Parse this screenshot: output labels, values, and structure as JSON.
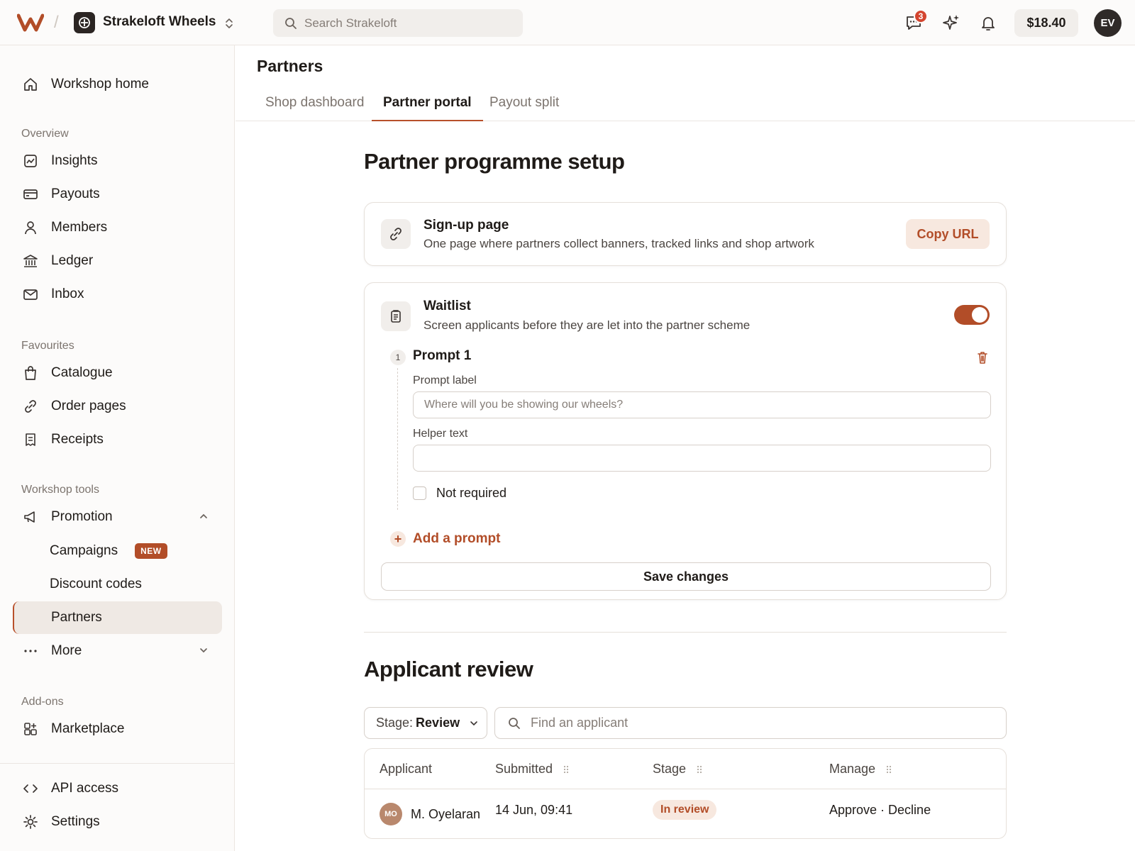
{
  "topbar": {
    "workspace_name": "Strakeloft Wheels",
    "search_placeholder": "Search Strakeloft",
    "chat_badge_count": "3",
    "credit": "$18.40",
    "avatar_initials": "EV",
    "accent_color": "#b24d28"
  },
  "sidebar": {
    "home": "Workshop home",
    "overview_label": "Overview",
    "overview_items": [
      "Insights",
      "Payouts",
      "Members",
      "Ledger",
      "Inbox"
    ],
    "favourites_label": "Favourites",
    "favourites_items": [
      "Catalogue",
      "Order pages",
      "Receipts"
    ],
    "tools_label": "Workshop tools",
    "promotion": "Promotion",
    "promotion_children": [
      "Campaigns",
      "Discount codes",
      "Partners"
    ],
    "new_badge": "NEW",
    "more": "More",
    "addons_label": "Add-ons",
    "marketplace": "Marketplace",
    "api_access": "API access",
    "settings": "Settings"
  },
  "main": {
    "page_title": "Partners",
    "tabs": [
      "Shop dashboard",
      "Partner portal",
      "Payout split"
    ],
    "active_tab": "Partner portal",
    "setup_heading": "Partner programme setup",
    "signup": {
      "title": "Sign-up page",
      "desc": "One page where partners collect banners, tracked links and shop artwork",
      "copy_label": "Copy URL"
    },
    "waitlist": {
      "title": "Waitlist",
      "desc": "Screen applicants before they are let into the partner scheme",
      "enabled": true,
      "step_number": "1",
      "prompt_title": "Prompt 1",
      "prompt_label_label": "Prompt label",
      "prompt_label_placeholder": "Where will you be showing our wheels?",
      "helper_label": "Helper text",
      "helper_value": "",
      "not_required_label": "Not required",
      "add_prompt_label": "Add a prompt",
      "save_label": "Save changes"
    },
    "review_heading": "Applicant review",
    "stage_filter_key": "Stage:",
    "stage_filter_value": "Review",
    "find_placeholder": "Find an applicant",
    "table": {
      "columns": [
        "Applicant",
        "Submitted",
        "Stage",
        "Manage"
      ],
      "rows": [
        {
          "initials": "MO",
          "name": "M. Oyelaran",
          "submitted": "14 Jun, 09:41",
          "stage": "In review",
          "approve": "Approve",
          "separator": " · ",
          "decline": "Decline"
        }
      ]
    }
  }
}
